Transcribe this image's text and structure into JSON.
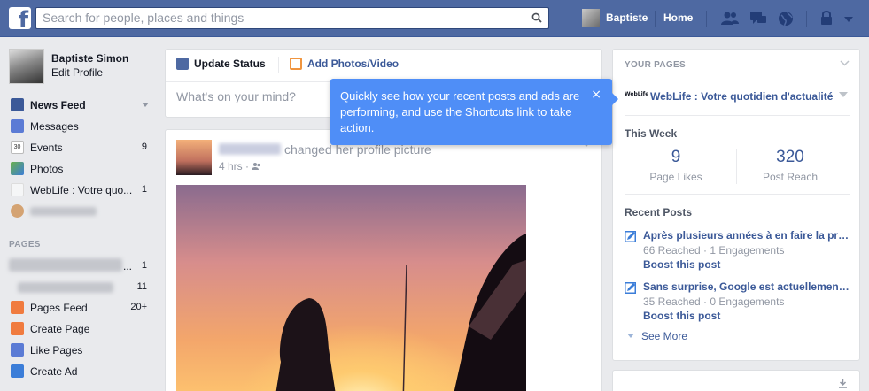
{
  "topbar": {
    "logo": "f",
    "search_placeholder": "Search for people, places and things",
    "user_name": "Baptiste",
    "home_label": "Home"
  },
  "sidebar": {
    "profile_name": "Baptiste Simon",
    "edit_profile": "Edit Profile",
    "items": [
      {
        "label": "News Feed",
        "icon": "news-feed-icon"
      },
      {
        "label": "Messages",
        "icon": "messages-icon"
      },
      {
        "label": "Events",
        "count": "9",
        "icon": "events-icon",
        "icon_text": "30"
      },
      {
        "label": "Photos",
        "icon": "photos-icon"
      },
      {
        "label": "WebLife : Votre quo...",
        "count": "1",
        "icon": "weblife-icon"
      }
    ],
    "pages_section_title": "PAGES",
    "page_counts": [
      "1",
      "11"
    ],
    "page_ellipsis": "...",
    "bottom_items": [
      {
        "label": "Pages Feed",
        "count": "20+",
        "icon": "pages-feed-icon"
      },
      {
        "label": "Create Page",
        "icon": "create-page-icon"
      },
      {
        "label": "Like Pages",
        "icon": "like-pages-icon"
      },
      {
        "label": "Create Ad",
        "icon": "create-ad-icon"
      }
    ]
  },
  "composer": {
    "update_status": "Update Status",
    "add_photos": "Add Photos/Video",
    "placeholder": "What's on your mind?"
  },
  "story": {
    "action": "changed her profile picture",
    "time": "4 hrs · "
  },
  "tooltip": {
    "text": "Quickly see how your recent posts and ads are performing, and use the Shortcuts link to take action.",
    "close": "×"
  },
  "right_panel": {
    "title": "YOUR PAGES",
    "page_logo": "WebLife",
    "page_name": "WebLife : Votre quotidien d'actualité",
    "this_week": "This Week",
    "stats": [
      {
        "value": "9",
        "label": "Page Likes"
      },
      {
        "value": "320",
        "label": "Post Reach"
      }
    ],
    "recent_posts": "Recent Posts",
    "posts": [
      {
        "title": "Après plusieurs années à en faire la promotion",
        "meta": "66 Reached · 1 Engagements",
        "boost": "Boost this post"
      },
      {
        "title": "Sans surprise, Google est actuellement en tête",
        "meta": "35 Reached · 0 Engagements",
        "boost": "Boost this post"
      }
    ],
    "see_more": "See More"
  },
  "colors": {
    "brand_blue": "#4e69a2",
    "link_blue": "#3b5998",
    "tooltip_blue": "#4f8ef7",
    "page_bg": "#e9eaed"
  }
}
